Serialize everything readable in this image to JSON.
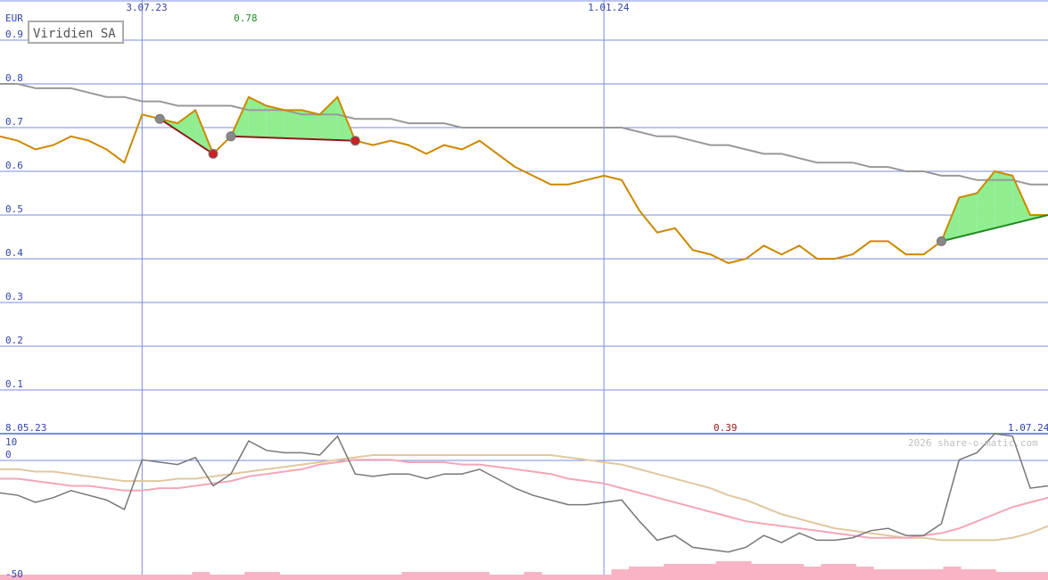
{
  "chart_data": [
    {
      "type": "line",
      "title": "Viridien SA",
      "currency": "EUR",
      "y_ticks": [
        "0.9",
        "0.8",
        "0.7",
        "0.6",
        "0.5",
        "0.4",
        "0.3",
        "0.2",
        "0.1"
      ],
      "ylim": [
        0.0,
        0.9
      ],
      "x_ticks": [
        {
          "label": "3.07.23",
          "index": 8
        },
        {
          "label": "1.01.24",
          "index": 34
        }
      ],
      "high_label": "0.78",
      "price": [
        0.68,
        0.67,
        0.65,
        0.66,
        0.68,
        0.67,
        0.65,
        0.62,
        0.73,
        0.72,
        0.71,
        0.74,
        0.64,
        0.68,
        0.77,
        0.75,
        0.74,
        0.74,
        0.73,
        0.77,
        0.67,
        0.66,
        0.67,
        0.66,
        0.64,
        0.66,
        0.65,
        0.67,
        0.64,
        0.61,
        0.59,
        0.57,
        0.57,
        0.58,
        0.59,
        0.58,
        0.51,
        0.46,
        0.47,
        0.42,
        0.41,
        0.39,
        0.4,
        0.43,
        0.41,
        0.43,
        0.4,
        0.4,
        0.41,
        0.44,
        0.44,
        0.41,
        0.41,
        0.44,
        0.54,
        0.55,
        0.6,
        0.59,
        0.5,
        0.5
      ],
      "moving_average": [
        0.8,
        0.8,
        0.79,
        0.79,
        0.79,
        0.78,
        0.77,
        0.77,
        0.76,
        0.76,
        0.75,
        0.75,
        0.75,
        0.75,
        0.74,
        0.74,
        0.74,
        0.73,
        0.73,
        0.73,
        0.72,
        0.72,
        0.72,
        0.71,
        0.71,
        0.71,
        0.7,
        0.7,
        0.7,
        0.7,
        0.7,
        0.7,
        0.7,
        0.7,
        0.7,
        0.7,
        0.69,
        0.68,
        0.68,
        0.67,
        0.66,
        0.66,
        0.65,
        0.64,
        0.64,
        0.63,
        0.62,
        0.62,
        0.62,
        0.61,
        0.61,
        0.6,
        0.6,
        0.59,
        0.59,
        0.58,
        0.58,
        0.58,
        0.57,
        0.57
      ],
      "series": [
        {
          "name": "",
          "color": "#cc8800"
        },
        {
          "name": "",
          "color": "#999999"
        }
      ],
      "colors": {
        "grid": "#7a8ce0",
        "fill_up": "#90ee90",
        "fill_down": "#ffb6c1",
        "dark_red": "#8b1a1a",
        "green_line": "#228b22"
      }
    },
    {
      "type": "line",
      "x_tick_labels": [
        "8.05.23",
        "1.07.24"
      ],
      "x_tick_index": [
        0,
        60
      ],
      "low_label": "0.39",
      "copyright": "2026 share-o-matic.com",
      "y_ticks": [
        "10",
        "0",
        "-50"
      ],
      "ylim": [
        -50,
        10
      ],
      "oscillator": [
        -16,
        -17,
        -20,
        -18,
        -15,
        -17,
        -19,
        -23,
        -2,
        -3,
        -4,
        -1,
        -13,
        -8,
        6,
        2,
        1,
        1,
        0,
        8,
        -8,
        -9,
        -8,
        -8,
        -10,
        -8,
        -8,
        -6,
        -10,
        -14,
        -17,
        -19,
        -21,
        -21,
        -20,
        -19,
        -28,
        -36,
        -34,
        -39,
        -40,
        -41,
        -39,
        -34,
        -37,
        -33,
        -36,
        -36,
        -35,
        -32,
        -31,
        -34,
        -34,
        -29,
        -2,
        1,
        9,
        8,
        -14,
        -13
      ],
      "signal_pink": [
        -10,
        -10,
        -11,
        -12,
        -13,
        -13,
        -14,
        -15,
        -15,
        -14,
        -14,
        -13,
        -12,
        -11,
        -9,
        -8,
        -7,
        -6,
        -4,
        -3,
        -2,
        -2,
        -2,
        -3,
        -3,
        -3,
        -4,
        -4,
        -5,
        -6,
        -7,
        -8,
        -10,
        -11,
        -12,
        -14,
        -16,
        -18,
        -20,
        -22,
        -24,
        -26,
        -28,
        -29,
        -30,
        -31,
        -32,
        -33,
        -34,
        -35,
        -35,
        -35,
        -34,
        -33,
        -31,
        -28,
        -25,
        -22,
        -20,
        -18
      ],
      "signal_tan": [
        -6,
        -6,
        -7,
        -7,
        -8,
        -9,
        -10,
        -11,
        -11,
        -11,
        -10,
        -10,
        -9,
        -8,
        -7,
        -6,
        -5,
        -4,
        -3,
        -2,
        -1,
        0,
        0,
        0,
        0,
        0,
        0,
        0,
        0,
        0,
        0,
        0,
        -1,
        -2,
        -3,
        -4,
        -6,
        -8,
        -10,
        -12,
        -14,
        -17,
        -19,
        -22,
        -25,
        -27,
        -29,
        -31,
        -32,
        -33,
        -34,
        -35,
        -35,
        -36,
        -36,
        -36,
        -36,
        -35,
        -33,
        -30
      ],
      "volume": [
        2,
        2,
        2,
        2,
        2,
        2,
        2,
        2,
        2,
        2,
        2,
        3,
        2,
        2,
        3,
        3,
        2,
        2,
        2,
        2,
        2,
        2,
        2,
        3,
        3,
        3,
        3,
        3,
        2,
        2,
        3,
        2,
        2,
        2,
        2,
        4,
        5,
        5,
        6,
        6,
        6,
        7,
        7,
        6,
        6,
        6,
        5,
        6,
        6,
        5,
        4,
        4,
        4,
        4,
        5,
        4,
        4,
        3,
        3,
        3
      ],
      "colors": {
        "oscillator": "#777777",
        "signal_pink": "#f4a6b8",
        "signal_tan": "#e0c8a0",
        "volume": "#f9b3c4"
      }
    }
  ]
}
